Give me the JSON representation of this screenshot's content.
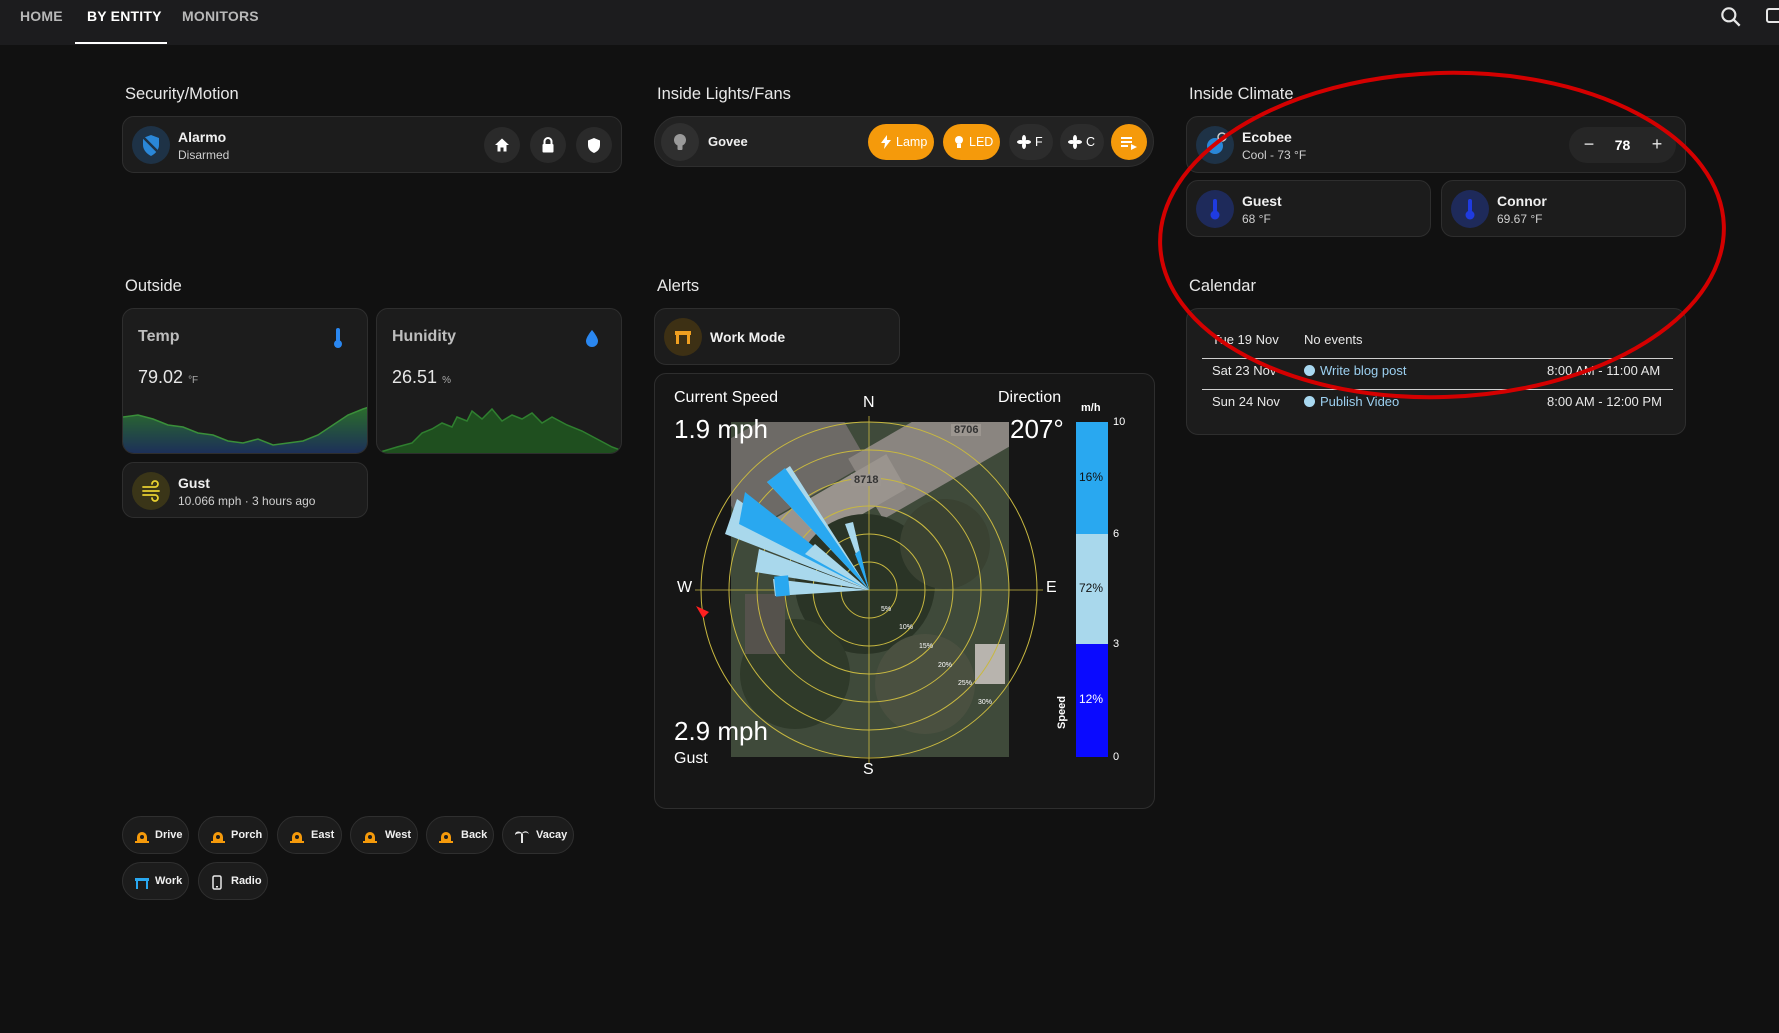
{
  "nav": {
    "tabs": [
      {
        "label": "HOME",
        "active": false
      },
      {
        "label": "BY ENTITY",
        "active": true
      },
      {
        "label": "MONITORS",
        "active": false
      }
    ]
  },
  "sections": {
    "security": "Security/Motion",
    "lights": "Inside Lights/Fans",
    "climate": "Inside Climate",
    "outside": "Outside",
    "alerts": "Alerts",
    "calendar": "Calendar"
  },
  "alarm": {
    "name": "Alarmo",
    "state": "Disarmed",
    "buttons": [
      "home-icon",
      "lock-icon",
      "shield-icon"
    ]
  },
  "lights": {
    "name": "Govee",
    "pills": [
      {
        "label": "Lamp",
        "icon": "bolt-icon",
        "on": true
      },
      {
        "label": "LED",
        "icon": "bulb-icon",
        "on": true
      },
      {
        "label": "F",
        "icon": "fan-icon",
        "on": false
      },
      {
        "label": "C",
        "icon": "fan-icon",
        "on": false
      }
    ]
  },
  "thermostat": {
    "name": "Ecobee",
    "state": "Cool - 73 °F",
    "setpoint": "78",
    "minus": "−",
    "plus": "+"
  },
  "rooms": [
    {
      "name": "Guest",
      "temp": "68 °F"
    },
    {
      "name": "Connor",
      "temp": "69.67 °F"
    }
  ],
  "outside": {
    "temp": {
      "label": "Temp",
      "value": "79.02",
      "unit": "°F"
    },
    "humidity": {
      "label": "Hunidity",
      "value": "26.51",
      "unit": "%"
    },
    "gust": {
      "name": "Gust",
      "detail": "10.066 mph · 3 hours ago"
    }
  },
  "alerts": {
    "work_mode": "Work Mode"
  },
  "wind": {
    "current_label": "Current Speed",
    "current_value": "1.9 mph",
    "direction_label": "Direction",
    "direction_value": "207°",
    "gust_value": "2.9 mph",
    "gust_label": "Gust",
    "compass": {
      "n": "N",
      "s": "S",
      "e": "E",
      "w": "W"
    },
    "rings": [
      "5%",
      "10%",
      "15%",
      "20%",
      "25%",
      "30%"
    ],
    "map_labels": [
      "8706",
      "8718"
    ],
    "scale_unit": "m/h",
    "scale_title": "Speed",
    "scale_ticks": [
      "10",
      "6",
      "3",
      "0"
    ],
    "scale_segments": [
      {
        "percent": "16%",
        "color": "#29a8f0"
      },
      {
        "percent": "72%",
        "color": "#a9d8ec"
      },
      {
        "percent": "12%",
        "color": "#0a0aff"
      }
    ]
  },
  "calendar": {
    "events": [
      {
        "date": "Tue 19 Nov",
        "title": "No events",
        "time": ""
      },
      {
        "date": "Sat 23 Nov",
        "title": "Write blog post",
        "time": "8:00 AM - 11:00 AM"
      },
      {
        "date": "Sun 24 Nov",
        "title": "Publish Video",
        "time": "8:00 AM - 12:00 PM"
      }
    ]
  },
  "chips": [
    {
      "label": "Drive",
      "icon": "camera-icon"
    },
    {
      "label": "Porch",
      "icon": "camera-icon"
    },
    {
      "label": "East",
      "icon": "camera-icon"
    },
    {
      "label": "West",
      "icon": "camera-icon"
    },
    {
      "label": "Back",
      "icon": "camera-icon"
    },
    {
      "label": "Vacay",
      "icon": "palm-icon"
    },
    {
      "label": "Work",
      "icon": "desk-icon"
    },
    {
      "label": "Radio",
      "icon": "phone-icon"
    }
  ],
  "annotation_color": "#d40000"
}
